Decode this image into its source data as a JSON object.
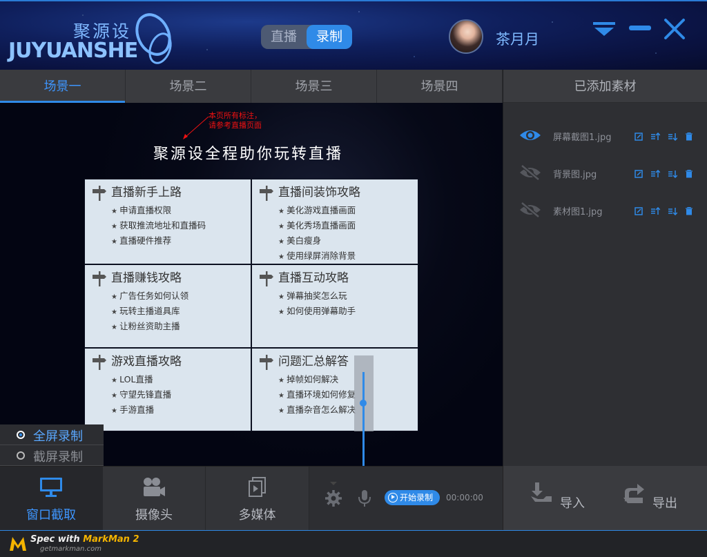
{
  "brand": {
    "cn": "聚源设",
    "en": "JUYUANSHE"
  },
  "mode_toggle": {
    "live": "直播",
    "record": "录制",
    "active": "record"
  },
  "user": {
    "name": "茶月月"
  },
  "scene_tabs": [
    {
      "label": "场景一",
      "active": true
    },
    {
      "label": "场景二",
      "active": false
    },
    {
      "label": "场景三",
      "active": false
    },
    {
      "label": "场景四",
      "active": false
    }
  ],
  "assets_panel": {
    "title": "已添加素材",
    "items": [
      {
        "name": "屏幕截图1.jpg",
        "visible": true
      },
      {
        "name": "背景图.jpg",
        "visible": false
      },
      {
        "name": "素材图1.jpg",
        "visible": false
      }
    ]
  },
  "preview": {
    "note_line1": "本页所有标注，",
    "note_line2": "请参考直播页面",
    "title": "聚源设全程助你玩转直播",
    "cards": [
      {
        "title": "直播新手上路",
        "items": [
          "申请直播权限",
          "获取推流地址和直播码",
          "直播硬件推荐"
        ]
      },
      {
        "title": "直播间装饰攻略",
        "items": [
          "美化游戏直播画面",
          "美化秀场直播画面",
          "美白瘦身",
          "使用绿屏消除背景"
        ]
      },
      {
        "title": "直播赚钱攻略",
        "items": [
          "广告任务如何认领",
          "玩转主播道具库",
          "让粉丝资助主播"
        ]
      },
      {
        "title": "直播互动攻略",
        "items": [
          "弹幕抽奖怎么玩",
          "如何使用弹幕助手"
        ]
      },
      {
        "title": "游戏直播攻略",
        "items": [
          "LOL直播",
          "守望先锋直播",
          "手游直播"
        ]
      },
      {
        "title": "问题汇总解答",
        "items": [
          "掉帧如何解决",
          "直播环境如何修复",
          "直播杂音怎么解决"
        ]
      }
    ]
  },
  "capture_mode": {
    "options": [
      {
        "label": "全屏录制",
        "selected": true
      },
      {
        "label": "截屏录制",
        "selected": false
      }
    ]
  },
  "sources": [
    {
      "label": "窗口截取",
      "icon": "monitor-icon",
      "active": true
    },
    {
      "label": "摄像头",
      "icon": "camera-icon",
      "active": false
    },
    {
      "label": "多媒体",
      "icon": "media-icon",
      "active": false
    }
  ],
  "controls": {
    "record_label": "开始录制",
    "timer": "00:00:00",
    "volume_level": 0.6
  },
  "io": {
    "import_label": "导入",
    "export_label": "导出"
  },
  "footer": {
    "spec_prefix": "Spec with ",
    "spec_brand": "MarkMan 2",
    "site": "getmarkman.com"
  },
  "colors": {
    "accent": "#2f8ae8",
    "panel": "#3a3b3f",
    "preview_bg": "#030512",
    "card_bg": "#dbe5ee"
  }
}
